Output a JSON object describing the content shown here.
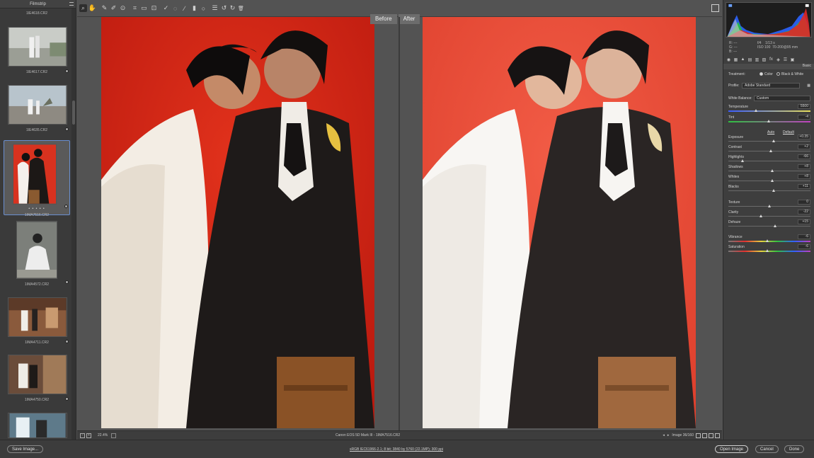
{
  "filmstrip": {
    "title": "Filmstrip",
    "top_fname": "1IE4618.CR2",
    "items": [
      {
        "fname": "1IE4617.CR2"
      },
      {
        "fname": "1IE4635.CR2"
      },
      {
        "fname": "1IMA7516.CR2",
        "stars": "• • • • •"
      },
      {
        "fname": "1IMA4572.CR2"
      },
      {
        "fname": "1IMA4711.CR2"
      },
      {
        "fname": "1IMA4750.CR2"
      }
    ]
  },
  "toolbar": {
    "tools": [
      {
        "name": "zoom-tool",
        "glyph": "⌕"
      },
      {
        "name": "hand-tool",
        "glyph": "✋"
      },
      {
        "name": "white-balance-tool",
        "glyph": "✎"
      },
      {
        "name": "color-sampler-tool",
        "glyph": "✐"
      },
      {
        "name": "targeted-adjustment-tool",
        "glyph": "⊙"
      },
      {
        "name": "crop-tool",
        "glyph": "⌗"
      },
      {
        "name": "straighten-tool",
        "glyph": "▭"
      },
      {
        "name": "transform-tool",
        "glyph": "⊡"
      },
      {
        "name": "spot-removal-tool",
        "glyph": "✓"
      },
      {
        "name": "red-eye-tool",
        "glyph": "◌"
      },
      {
        "name": "adjustment-brush-tool",
        "glyph": "∕"
      },
      {
        "name": "graduated-filter-tool",
        "glyph": "▮"
      },
      {
        "name": "radial-filter-tool",
        "glyph": "○"
      },
      {
        "name": "preferences-tool",
        "glyph": "☰"
      },
      {
        "name": "rotate-left-tool",
        "glyph": "↺"
      },
      {
        "name": "rotate-right-tool",
        "glyph": "↻"
      },
      {
        "name": "delete-tool",
        "glyph": "🗑"
      }
    ]
  },
  "compare": {
    "before": "Before",
    "after": "After"
  },
  "status": {
    "zoom": "22.4%",
    "camera_file": "Canon EOS 5D Mark III  -  1IMA7516.CR2",
    "image_count": "Image 36/160"
  },
  "histogram": {
    "r_label": "R:",
    "g_label": "G:",
    "b_label": "B:",
    "r_val": "---",
    "g_val": "---",
    "b_val": "---",
    "aperture": "f/4",
    "shutter": "1/13 s",
    "iso": "ISO 100",
    "lens": "70-200@95 mm"
  },
  "basic": {
    "title": "Basic",
    "treatment_label": "Treatment:",
    "treatment_color": "Color",
    "treatment_bw": "Black & White",
    "profile_label": "Profile:",
    "profile_value": "Adobe Standard",
    "wb_label": "White Balance:",
    "wb_value": "Custom",
    "auto_label": "Auto",
    "default_label": "Default",
    "sliders": {
      "temperature": {
        "label": "Temperature",
        "value": "5500"
      },
      "tint": {
        "label": "Tint",
        "value": "-4"
      },
      "exposure": {
        "label": "Exposure",
        "value": "+0.35"
      },
      "contrast": {
        "label": "Contrast",
        "value": "+2"
      },
      "highlights": {
        "label": "Highlights",
        "value": "-66"
      },
      "shadows": {
        "label": "Shadows",
        "value": "+8"
      },
      "whites": {
        "label": "Whites",
        "value": "+8"
      },
      "blacks": {
        "label": "Blacks",
        "value": "+11"
      },
      "texture": {
        "label": "Texture",
        "value": "0"
      },
      "clarity": {
        "label": "Clarity",
        "value": "-22"
      },
      "dehaze": {
        "label": "Dehaze",
        "value": "+15"
      },
      "vibrance": {
        "label": "Vibrance",
        "value": "-6"
      },
      "saturation": {
        "label": "Saturation",
        "value": "-6"
      }
    }
  },
  "bottom": {
    "save_image": "Save Image...",
    "workflow": "sRGB IEC61966-2.1; 8 bit; 3840 by 5760 (22.1MP); 300 ppi",
    "open_image": "Open Image",
    "cancel": "Cancel",
    "done": "Done"
  },
  "colors": {
    "selection": "#6a8fd0",
    "backdrop": "#d8321f"
  }
}
